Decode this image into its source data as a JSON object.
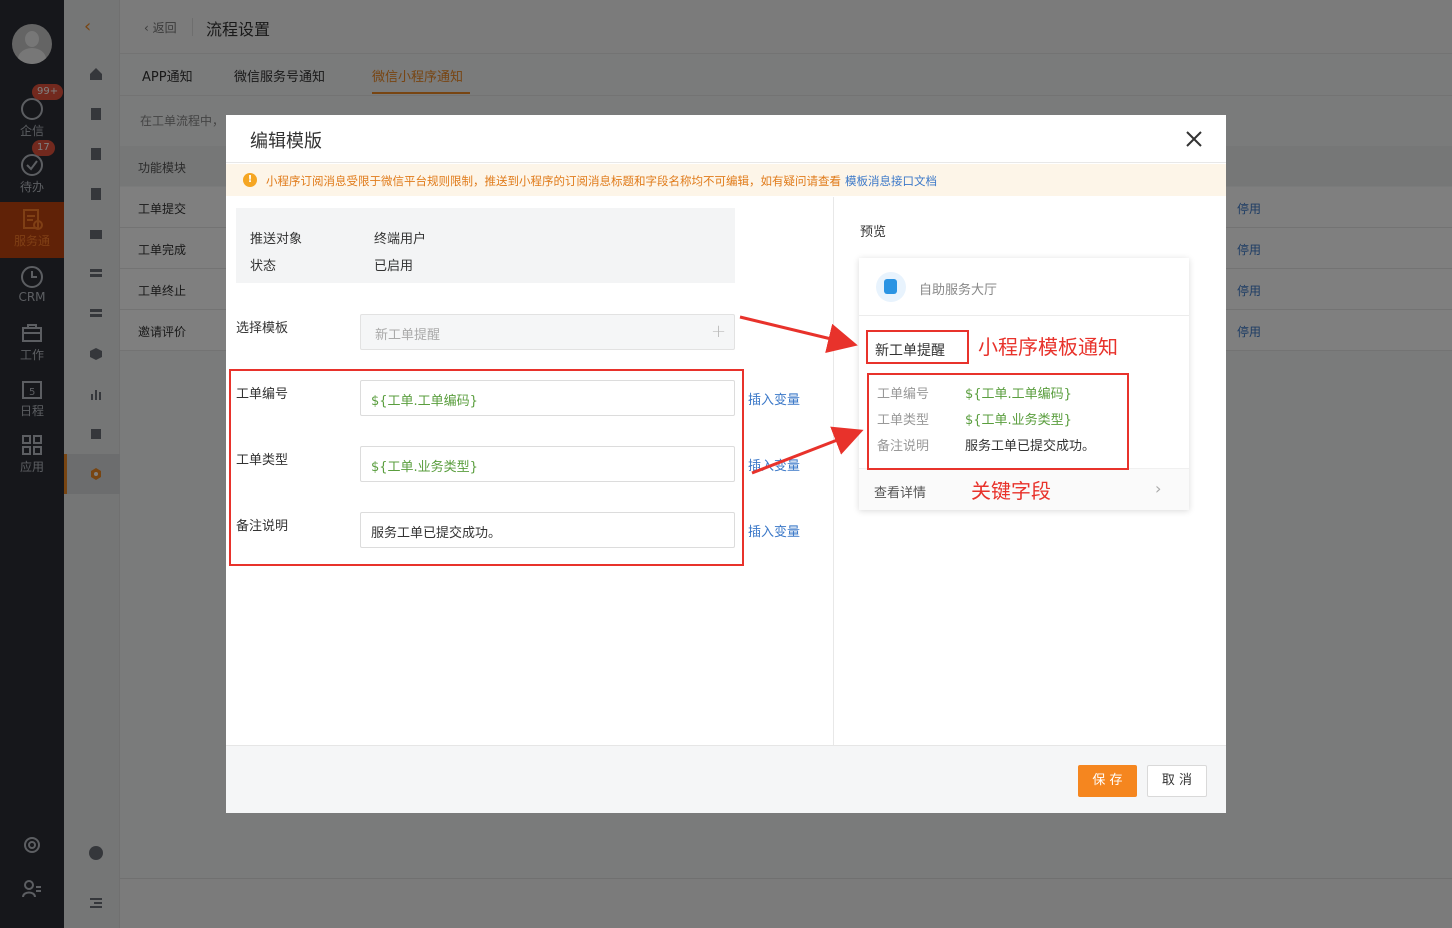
{
  "sidebar": {
    "items": [
      {
        "label": "企信",
        "badge": "99+"
      },
      {
        "label": "待办",
        "badge": "17"
      },
      {
        "label": "服务通",
        "badge": ""
      },
      {
        "label": "CRM",
        "badge": ""
      },
      {
        "label": "工作",
        "badge": ""
      },
      {
        "label": "日程",
        "badge": ""
      },
      {
        "label": "应用",
        "badge": ""
      }
    ]
  },
  "header": {
    "back_label": "返回",
    "title": "流程设置"
  },
  "tabs": [
    {
      "label": "APP通知"
    },
    {
      "label": "微信服务号通知"
    },
    {
      "label": "微信小程序通知"
    }
  ],
  "page": {
    "hint": "在工单流程中，",
    "table_header": "功能模块",
    "rows": [
      {
        "name": "工单提交",
        "action": "停用"
      },
      {
        "name": "工单完成",
        "action": "停用"
      },
      {
        "name": "工单终止",
        "action": "停用"
      },
      {
        "name": "邀请评价",
        "action": "停用"
      }
    ]
  },
  "modal": {
    "title": "编辑模版",
    "warning": "小程序订阅消息受限于微信平台规则限制，推送到小程序的订阅消息标题和字段名称均不可编辑，如有疑问请查看",
    "warning_link": "模板消息接口文档",
    "info": {
      "target_label": "推送对象",
      "target_value": "终端用户",
      "status_label": "状态",
      "status_value": "已启用"
    },
    "template_label": "选择模板",
    "template_placeholder": "新工单提醒",
    "fields": [
      {
        "label": "工单编号",
        "value": "${工单.工单编码}",
        "insert": "插入变量"
      },
      {
        "label": "工单类型",
        "value": "${工单.业务类型}",
        "insert": "插入变量"
      },
      {
        "label": "备注说明",
        "value": "服务工单已提交成功。",
        "insert": "插入变量"
      }
    ],
    "preview": {
      "title": "预览",
      "app_name": "自助服务大厅",
      "message_title": "新工单提醒",
      "fields": [
        {
          "label": "工单编号",
          "value": "${工单.工单编码}"
        },
        {
          "label": "工单类型",
          "value": "${工单.业务类型}"
        },
        {
          "label": "备注说明",
          "value": "服务工单已提交成功。"
        }
      ],
      "detail_label": "查看详情"
    },
    "annotations": {
      "template_note": "小程序模板通知",
      "fields_note": "关键字段"
    },
    "buttons": {
      "save": "保 存",
      "cancel": "取 消"
    }
  },
  "colors": {
    "accent": "#f5861f",
    "link": "#3b78c8",
    "variable": "#5a9e3e",
    "annotation": "#e8322b"
  }
}
